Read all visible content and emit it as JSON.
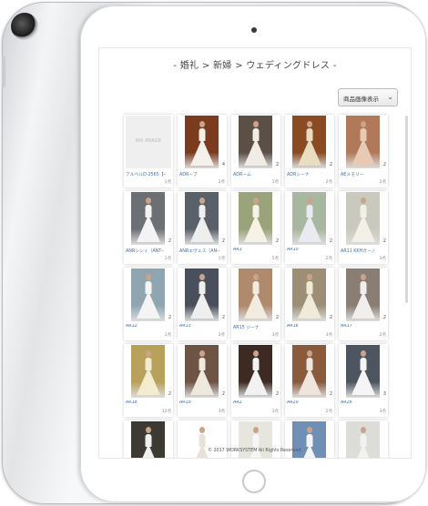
{
  "breadcrumb": "- 婚礼 > 新婦 > ウェディングドレス -",
  "sort_select": {
    "value": "商品画像表示"
  },
  "footer": "© 2017 WORKSYSTEM All Rights Reserved.",
  "no_image_text": "NO IMAGE",
  "items": [
    {
      "name": "アルベルD-2565【一",
      "num": "",
      "count": "1点",
      "bg": "#ffffff",
      "dress": "",
      "noimage": true
    },
    {
      "name": "ADRーブ",
      "num": "4",
      "count": "2点",
      "bg": "#7a3b1e",
      "dress": "#f4f0ea",
      "noimage": false
    },
    {
      "name": "ADRーム",
      "num": "2",
      "count": "1点",
      "bg": "#5c5046",
      "dress": "#f1ede6",
      "noimage": false
    },
    {
      "name": "ADRシーナ",
      "num": "2",
      "count": "2点",
      "bg": "#8a4a22",
      "dress": "#e9dcc0",
      "noimage": false
    },
    {
      "name": "AEメモリー",
      "num": "2",
      "count": "2点",
      "bg": "#b07a5a",
      "dress": "#e7c9b4",
      "noimage": false
    },
    {
      "name": "ANRシシィ（ANT--",
      "num": "2",
      "count": "1点",
      "bg": "#6c6f74",
      "dress": "#f3f3f3",
      "noimage": false
    },
    {
      "name": "ANRエヴェス（AN--",
      "num": "2",
      "count": "1点",
      "bg": "#5a606a",
      "dress": "#eeeeee",
      "noimage": false
    },
    {
      "name": "AR1",
      "num": "2",
      "count": "5点",
      "bg": "#9aa37a",
      "dress": "#f6f3e6",
      "noimage": false
    },
    {
      "name": "AR10",
      "num": "2",
      "count": "2点",
      "bg": "#a8b7a0",
      "dress": "#eaeaf2",
      "noimage": false
    },
    {
      "name": "AR11 KKHガーノ",
      "num": "2",
      "count": "3点",
      "bg": "#c9c9bd",
      "dress": "#f3f0e8",
      "noimage": false
    },
    {
      "name": "AR12",
      "num": "2",
      "count": "1点",
      "bg": "#8fa6b0",
      "dress": "#f4f4f4",
      "noimage": false
    },
    {
      "name": "AR13",
      "num": "2",
      "count": "2点",
      "bg": "#4a4f5c",
      "dress": "#efefef",
      "noimage": false
    },
    {
      "name": "AR15 ジーナ",
      "num": "2",
      "count": "3点",
      "bg": "#b08a6c",
      "dress": "#f2ebe0",
      "noimage": false
    },
    {
      "name": "AR16",
      "num": "2",
      "count": "3点",
      "bg": "#9c8f76",
      "dress": "#f0ead8",
      "noimage": false
    },
    {
      "name": "AR17",
      "num": "2",
      "count": "2点",
      "bg": "#8a7e74",
      "dress": "#f1efee",
      "noimage": false
    },
    {
      "name": "AR18",
      "num": "2",
      "count": "12点",
      "bg": "#b8a15a",
      "dress": "#f3ecd0",
      "noimage": false
    },
    {
      "name": "AR19",
      "num": "2",
      "count": "3点",
      "bg": "#6e5444",
      "dress": "#efe8de",
      "noimage": false
    },
    {
      "name": "AR2",
      "num": "2",
      "count": "3点",
      "bg": "#3d2a22",
      "dress": "#f2f2f2",
      "noimage": false
    },
    {
      "name": "AR20",
      "num": "2",
      "count": "2点",
      "bg": "#8a5a3c",
      "dress": "#eee6dc",
      "noimage": false
    },
    {
      "name": "AR26",
      "num": "3",
      "count": "3点",
      "bg": "#4c5560",
      "dress": "#f5f5f5",
      "noimage": false
    },
    {
      "name": "",
      "num": "",
      "count": "",
      "bg": "#3c3a33",
      "dress": "#f0f0f0",
      "noimage": false
    },
    {
      "name": "",
      "num": "",
      "count": "",
      "bg": "#ffffff",
      "dress": "#e8e2d8",
      "noimage": false
    },
    {
      "name": "",
      "num": "",
      "count": "",
      "bg": "#e6e6df",
      "dress": "#f6f6f6",
      "noimage": false
    },
    {
      "name": "",
      "num": "",
      "count": "",
      "bg": "#6f8fb4",
      "dress": "#f4f4f4",
      "noimage": false
    },
    {
      "name": "",
      "num": "",
      "count": "",
      "bg": "#dcdcd8",
      "dress": "#f2f2f2",
      "noimage": false
    }
  ]
}
